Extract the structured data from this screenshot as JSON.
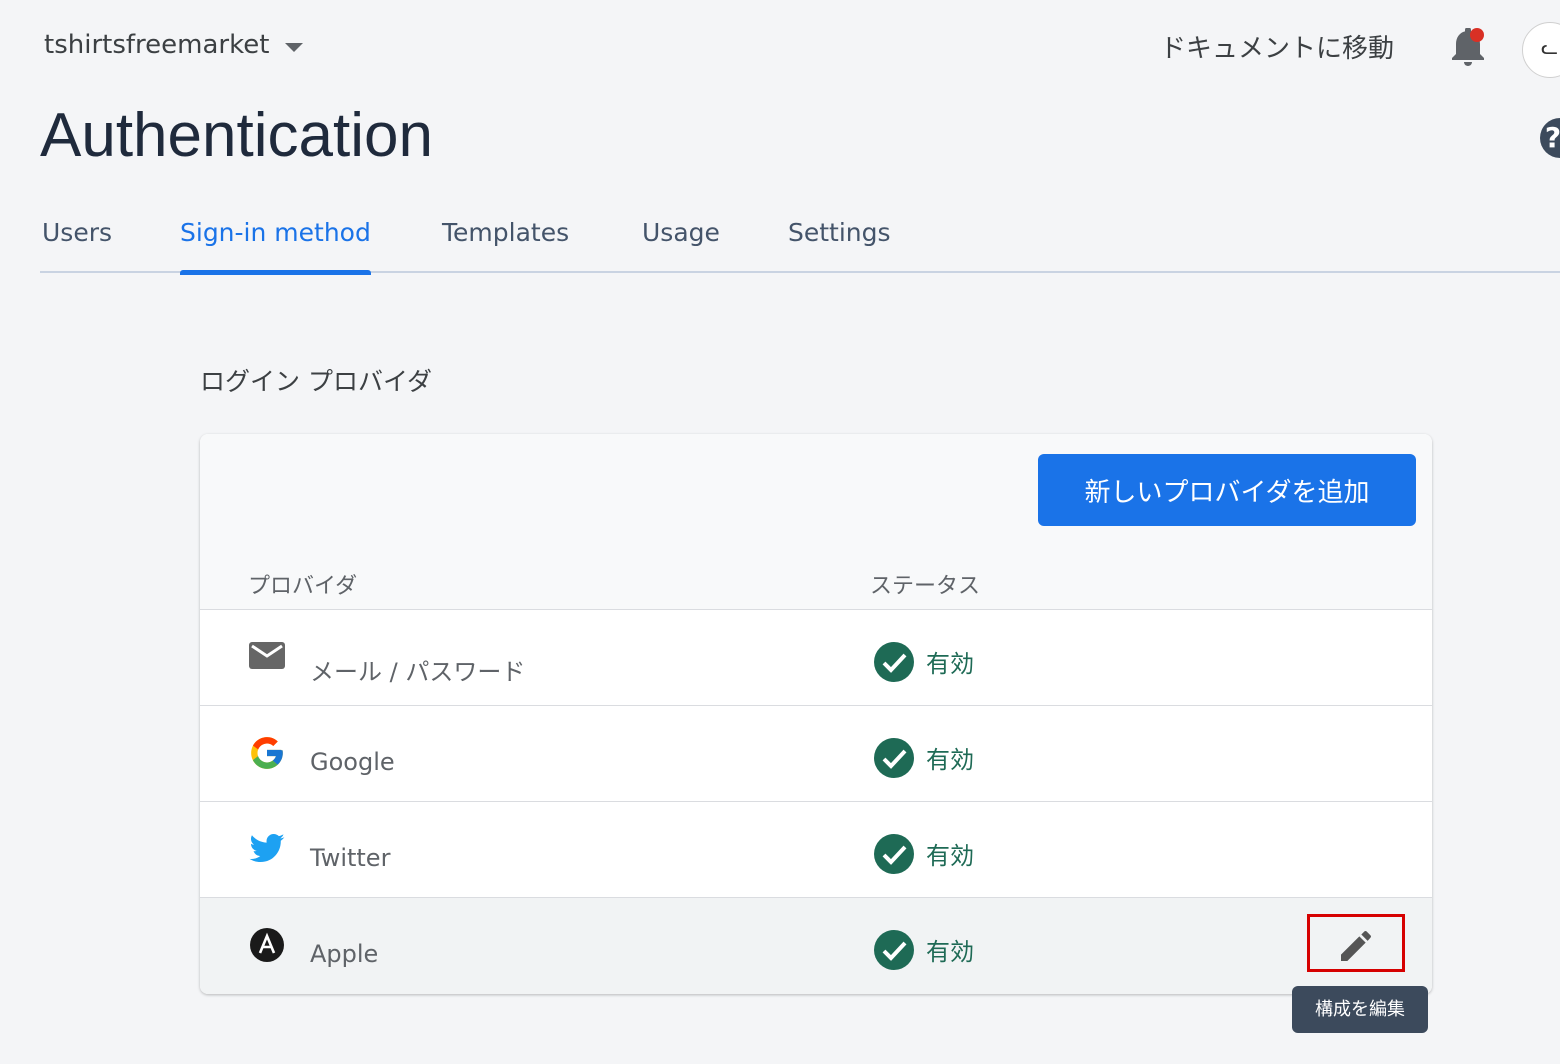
{
  "header": {
    "project_name": "tshirtsfreemarket",
    "docs_link": "ドキュメントに移動",
    "bell_icon": "notifications-bell-icon",
    "avatar_icon": "user-avatar",
    "help_icon": "help-icon"
  },
  "page": {
    "title": "Authentication"
  },
  "tabs": [
    {
      "label": "Users"
    },
    {
      "label": "Sign-in method"
    },
    {
      "label": "Templates"
    },
    {
      "label": "Usage"
    },
    {
      "label": "Settings"
    }
  ],
  "section": {
    "title": "ログイン プロバイダ"
  },
  "card": {
    "add_button": "新しいプロバイダを追加",
    "columns": {
      "provider": "プロバイダ",
      "status": "ステータス"
    },
    "rows": [
      {
        "icon": "email-icon",
        "name": "メール / パスワード",
        "status": "有効"
      },
      {
        "icon": "google-icon",
        "name": "Google",
        "status": "有効"
      },
      {
        "icon": "twitter-icon",
        "name": "Twitter",
        "status": "有効"
      },
      {
        "icon": "apple-icon",
        "name": "Apple",
        "status": "有効"
      }
    ]
  },
  "tooltip": {
    "text": "構成を編集"
  },
  "colors": {
    "accent": "#1a73e8",
    "enabled": "#1e6a55",
    "highlight": "#d60000"
  }
}
